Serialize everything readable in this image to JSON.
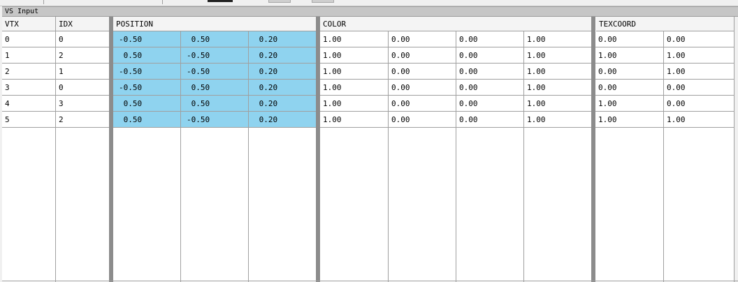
{
  "panel": {
    "title": "VS Input"
  },
  "columns": {
    "vtx": "VTX",
    "idx": "IDX",
    "position": "POSITION",
    "color": "COLOR",
    "texcoord": "TEXCOORD"
  },
  "rows": [
    {
      "vtx": "0",
      "idx": "0",
      "pos": [
        "-0.50",
        " 0.50",
        " 0.20"
      ],
      "color": [
        "1.00",
        "0.00",
        "0.00",
        "1.00"
      ],
      "tex": [
        "0.00",
        "0.00"
      ]
    },
    {
      "vtx": "1",
      "idx": "2",
      "pos": [
        " 0.50",
        "-0.50",
        " 0.20"
      ],
      "color": [
        "1.00",
        "0.00",
        "0.00",
        "1.00"
      ],
      "tex": [
        "1.00",
        "1.00"
      ]
    },
    {
      "vtx": "2",
      "idx": "1",
      "pos": [
        "-0.50",
        "-0.50",
        " 0.20"
      ],
      "color": [
        "1.00",
        "0.00",
        "0.00",
        "1.00"
      ],
      "tex": [
        "0.00",
        "1.00"
      ]
    },
    {
      "vtx": "3",
      "idx": "0",
      "pos": [
        "-0.50",
        " 0.50",
        " 0.20"
      ],
      "color": [
        "1.00",
        "0.00",
        "0.00",
        "1.00"
      ],
      "tex": [
        "0.00",
        "0.00"
      ]
    },
    {
      "vtx": "4",
      "idx": "3",
      "pos": [
        " 0.50",
        " 0.50",
        " 0.20"
      ],
      "color": [
        "1.00",
        "0.00",
        "0.00",
        "1.00"
      ],
      "tex": [
        "1.00",
        "0.00"
      ]
    },
    {
      "vtx": "5",
      "idx": "2",
      "pos": [
        " 0.50",
        "-0.50",
        " 0.20"
      ],
      "color": [
        "1.00",
        "0.00",
        "0.00",
        "1.00"
      ],
      "tex": [
        "1.00",
        "1.00"
      ]
    }
  ],
  "colors": {
    "selection": "#8fd3ef",
    "header": "#c6c6c6",
    "grid": "#a0a0a0"
  }
}
